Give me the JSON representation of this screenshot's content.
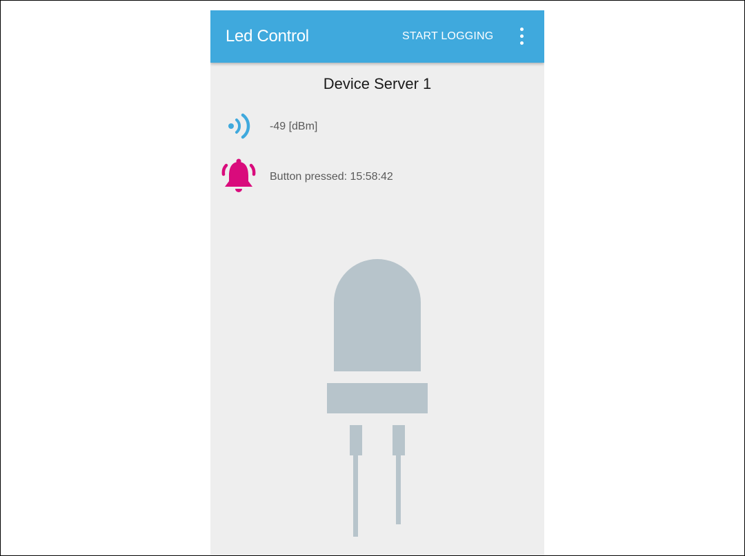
{
  "appbar": {
    "title": "Led Control",
    "action_label": "START LOGGING",
    "overflow_icon": "more-vert-icon",
    "color": "#3fa9dd"
  },
  "device": {
    "title": "Device Server 1"
  },
  "signal": {
    "icon": "signal-strength-icon",
    "text": "-49 [dBm]",
    "color": "#3fa9dd"
  },
  "alarm": {
    "icon": "bell-ringing-icon",
    "text": "Button pressed: 15:58:42",
    "color": "#d90b7c"
  },
  "led": {
    "icon": "led-icon",
    "state": "off",
    "color": "#b7c4cb"
  }
}
